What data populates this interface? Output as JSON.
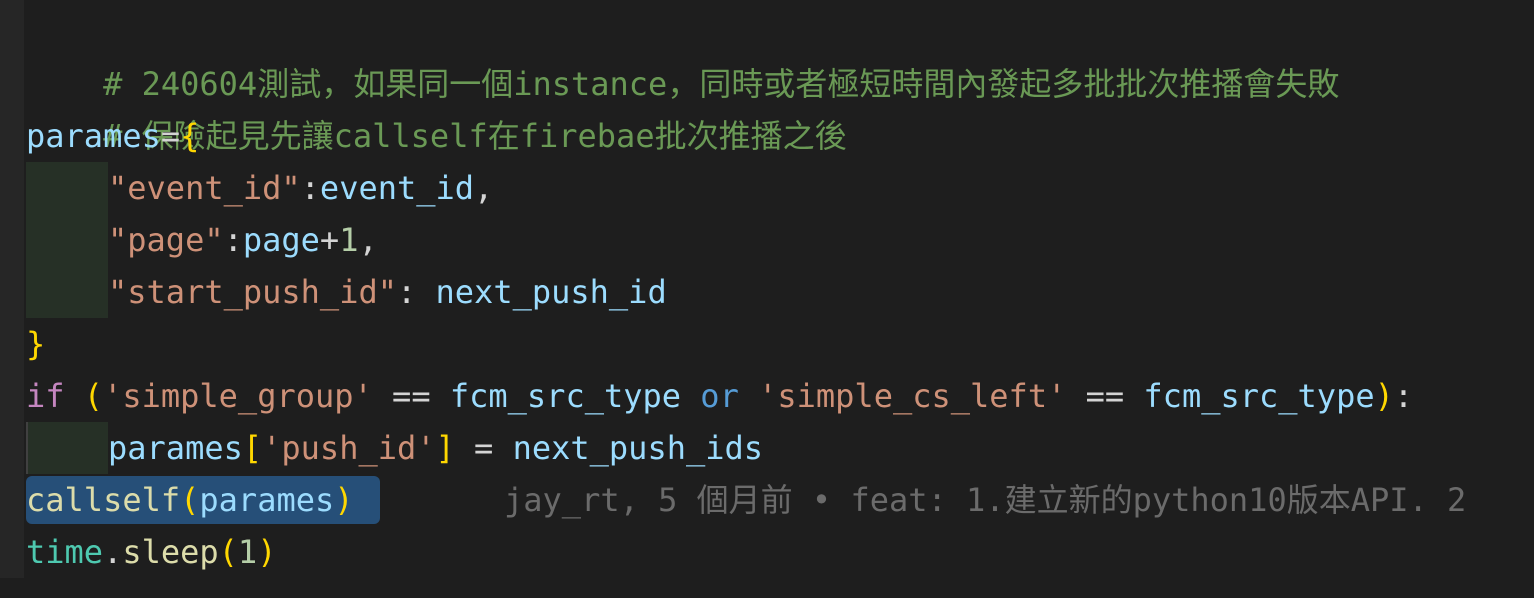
{
  "editor": {
    "lines": {
      "comment1": "# 240604測試，如果同一個instance，同時或者極短時間內發起多批批次推播會失敗",
      "comment2": "# 保險起見先讓callself在firebae批次推播之後",
      "l3": {
        "var": "parames",
        "op": "=",
        "brace": "{"
      },
      "l4": {
        "key": "\"event_id\"",
        "colon": ":",
        "val": "event_id",
        "comma": ","
      },
      "l5": {
        "key": "\"page\"",
        "colon": ":",
        "val": "page",
        "plus": "+",
        "num": "1",
        "comma": ","
      },
      "l6": {
        "key": "\"start_push_id\"",
        "colon": ": ",
        "val": "next_push_id"
      },
      "l7": {
        "brace": "}"
      },
      "l8": {
        "kw_if": "if",
        "paren_open": "(",
        "str1": "'simple_group'",
        "eq1": "==",
        "var1": "fcm_src_type",
        "kw_or": "or",
        "str2": "'simple_cs_left'",
        "eq2": "==",
        "var2": "fcm_src_type",
        "paren_close": ")",
        "colon": ":"
      },
      "l9": {
        "var": "parames",
        "br_open": "[",
        "str": "'push_id'",
        "br_close": "]",
        "eq": "=",
        "val": "next_push_ids"
      },
      "l10": {
        "fn": "callself",
        "paren_open": "(",
        "arg": "parames",
        "paren_close": ")"
      },
      "l11": {
        "obj": "time",
        "dot": ".",
        "fn": "sleep",
        "paren_open": "(",
        "num": "1",
        "paren_close": ")"
      }
    },
    "blame": "jay_rt, 5 個月前 • feat: 1.建立新的python10版本API. 2"
  },
  "colors": {
    "background": "#1e1e1e",
    "comment": "#6a9955",
    "variable": "#9cdcfe",
    "string": "#ce9178",
    "number": "#b5cea8",
    "keyword": "#c586c0",
    "operator_keyword": "#569cd6",
    "function": "#dcdcaa",
    "class": "#4ec9b0",
    "bracket_level1": "#ffd700",
    "bracket_level2": "#da70d6",
    "selection": "#264f78",
    "blame": "#6b6b6b"
  }
}
